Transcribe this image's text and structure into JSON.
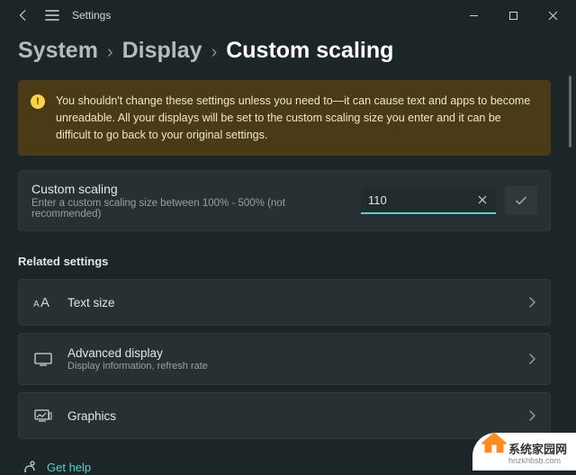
{
  "titlebar": {
    "title": "Settings"
  },
  "breadcrumb": {
    "items": [
      "System",
      "Display",
      "Custom scaling"
    ]
  },
  "warning": {
    "text": "You shouldn't change these settings unless you need to—it can cause text and apps to become unreadable. All your displays will be set to the custom scaling size you enter and it can be difficult to go back to your original settings."
  },
  "customScaling": {
    "title": "Custom scaling",
    "sub": "Enter a custom scaling size between 100% - 500% (not recommended)",
    "value": "110"
  },
  "related": {
    "heading": "Related settings",
    "items": [
      {
        "title": "Text size",
        "sub": ""
      },
      {
        "title": "Advanced display",
        "sub": "Display information, refresh rate"
      },
      {
        "title": "Graphics",
        "sub": ""
      }
    ]
  },
  "help": {
    "label": "Get help"
  },
  "watermark": {
    "title": "系统家园网",
    "url": "hnzkhbsb.com"
  }
}
